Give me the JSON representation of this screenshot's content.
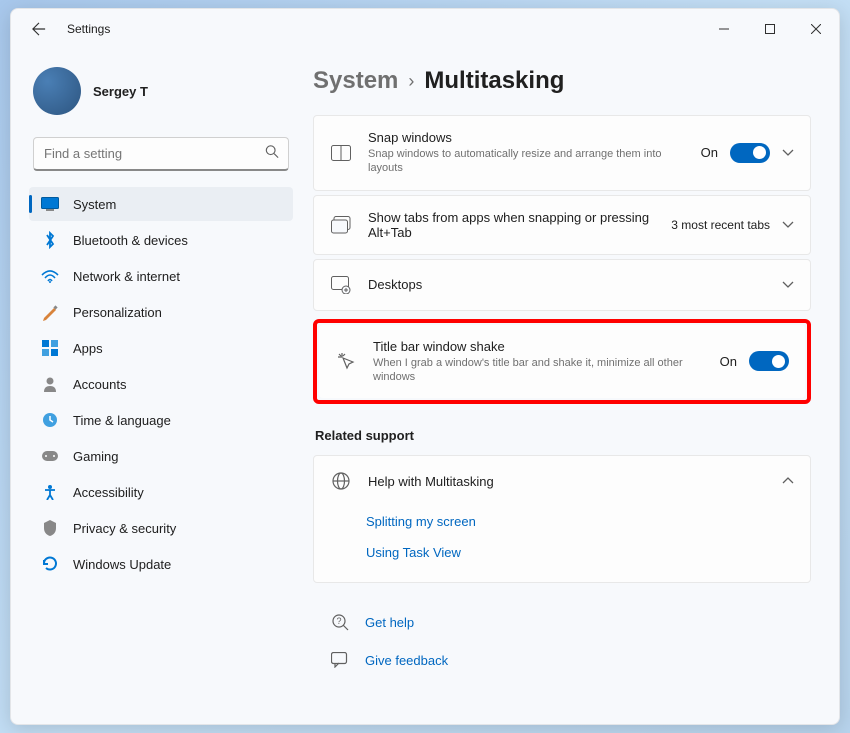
{
  "window": {
    "title": "Settings"
  },
  "profile": {
    "name": "Sergey T"
  },
  "search": {
    "placeholder": "Find a setting"
  },
  "nav": [
    {
      "label": "System",
      "active": true,
      "icon": "system"
    },
    {
      "label": "Bluetooth & devices",
      "active": false,
      "icon": "bluetooth"
    },
    {
      "label": "Network & internet",
      "active": false,
      "icon": "network"
    },
    {
      "label": "Personalization",
      "active": false,
      "icon": "personalization"
    },
    {
      "label": "Apps",
      "active": false,
      "icon": "apps"
    },
    {
      "label": "Accounts",
      "active": false,
      "icon": "accounts"
    },
    {
      "label": "Time & language",
      "active": false,
      "icon": "time"
    },
    {
      "label": "Gaming",
      "active": false,
      "icon": "gaming"
    },
    {
      "label": "Accessibility",
      "active": false,
      "icon": "accessibility"
    },
    {
      "label": "Privacy & security",
      "active": false,
      "icon": "privacy"
    },
    {
      "label": "Windows Update",
      "active": false,
      "icon": "update"
    }
  ],
  "breadcrumb": {
    "parent": "System",
    "current": "Multitasking"
  },
  "cards": {
    "snap": {
      "title": "Snap windows",
      "desc": "Snap windows to automatically resize and arrange them into layouts",
      "toggle_label": "On"
    },
    "tabs": {
      "title": "Show tabs from apps when snapping or pressing Alt+Tab",
      "value": "3 most recent tabs"
    },
    "desktops": {
      "title": "Desktops"
    },
    "shake": {
      "title": "Title bar window shake",
      "desc": "When I grab a window's title bar and shake it, minimize all other windows",
      "toggle_label": "On"
    }
  },
  "related": {
    "heading": "Related support",
    "help_title": "Help with Multitasking",
    "links": [
      "Splitting my screen",
      "Using Task View"
    ]
  },
  "footer": {
    "get_help": "Get help",
    "feedback": "Give feedback"
  }
}
